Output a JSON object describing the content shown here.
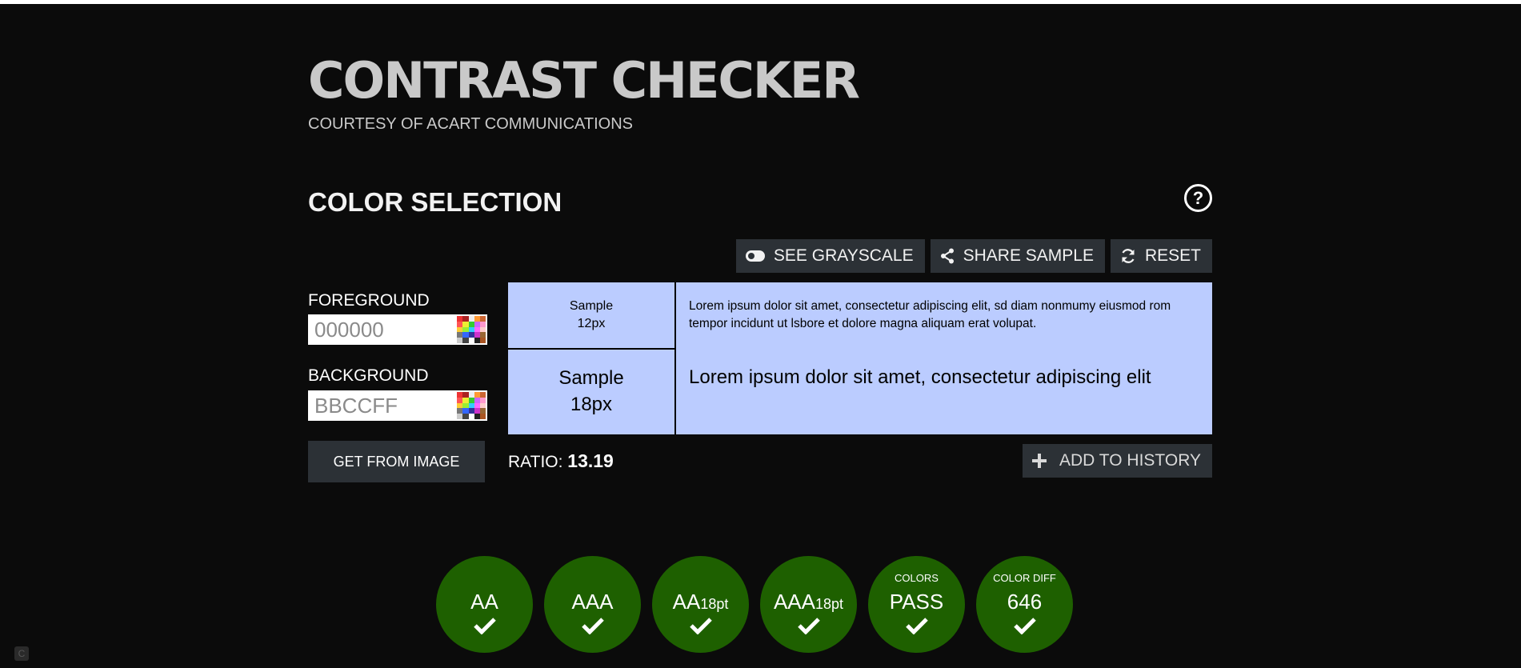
{
  "header": {
    "title": "CONTRAST CHECKER",
    "subtitle": "COURTESY OF ACART COMMUNICATIONS"
  },
  "section": {
    "title": "COLOR SELECTION",
    "help_icon": "question-circle-icon"
  },
  "toolbar": {
    "grayscale_label": "SEE GRAYSCALE",
    "share_label": "SHARE SAMPLE",
    "reset_label": "RESET"
  },
  "foreground": {
    "label": "FOREGROUND",
    "placeholder": "000000"
  },
  "background": {
    "label": "BACKGROUND",
    "placeholder": "BBCCFF"
  },
  "get_from_image_label": "GET FROM IMAGE",
  "preview": {
    "bg_color": "#bbccff",
    "fg_color": "#000000",
    "sample_small_line1": "Sample",
    "sample_small_line2": "12px",
    "sample_large_line1": "Sample",
    "sample_large_line2": "18px",
    "lorem_small": "Lorem ipsum dolor sit amet, consectetur adipiscing elit, sd diam nonmumy eiusmod rom tempor incidunt ut lsbore et dolore magna aliquam erat volupat.",
    "lorem_large": "Lorem ipsum dolor sit amet, consectetur adipiscing elit"
  },
  "ratio": {
    "label": "RATIO:",
    "value": "13.19"
  },
  "add_history_label": "ADD TO HISTORY",
  "results": [
    {
      "top": "",
      "main": "AA",
      "suffix": ""
    },
    {
      "top": "",
      "main": "AAA",
      "suffix": ""
    },
    {
      "top": "",
      "main": "AA",
      "suffix": "18pt"
    },
    {
      "top": "",
      "main": "AAA",
      "suffix": "18pt"
    },
    {
      "top": "COLORS",
      "main": "PASS",
      "suffix": ""
    },
    {
      "top": "COLOR DIFF",
      "main": "646",
      "suffix": ""
    }
  ],
  "colors": {
    "pass_green": "#1e6000",
    "button_bg": "#2c3136",
    "page_bg": "#0b0b0b"
  }
}
